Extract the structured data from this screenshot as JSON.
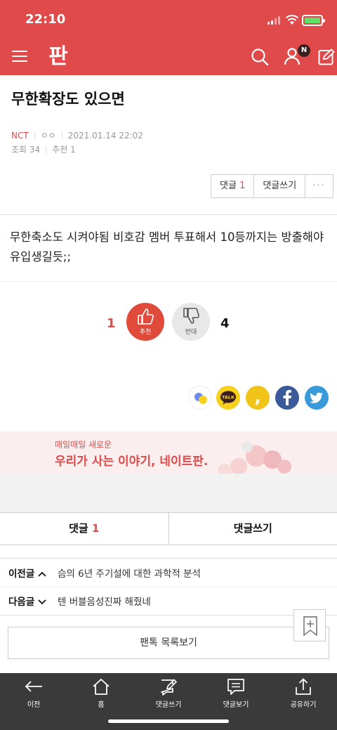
{
  "status": {
    "time": "22:10"
  },
  "header": {
    "logo_text": "판",
    "notification_badge": "N"
  },
  "article": {
    "title": "무한확장도 있으면",
    "author": "NCT",
    "author_id": "ㅇㅇ",
    "date": "2021.01.14 22:02",
    "views": "조회 34",
    "recommends": "추천 1",
    "body": "무한축소도 시켜야됨 비호감 멤버 투표해서 10등까지는 방출해야 유입생길듯;;"
  },
  "actions": {
    "comment_label": "댓글",
    "comment_count": "1",
    "write_comment": "댓글쓰기",
    "more": "···"
  },
  "vote": {
    "up_count": "1",
    "up_label": "추천",
    "down_label": "반대",
    "down_count": "4"
  },
  "share": {
    "talk_label": "TALK",
    "kakaostory_label": ","
  },
  "banner": {
    "sub": "매일매일 새로운",
    "main": "우리가 사는 이야기, 네이트판."
  },
  "tabs": {
    "comments_label": "댓글",
    "comments_count": "1",
    "write_label": "댓글쓰기"
  },
  "nav": {
    "prev_label": "이전글",
    "prev_title": "슴의 6년 주기설에 대한 과학적 분석",
    "next_label": "다음글",
    "next_title": "텐 버블음성진짜 해줬네"
  },
  "list_button": "팬톡 목록보기",
  "bottombar": {
    "back": "이전",
    "home": "홈",
    "write_comment": "댓글쓰기",
    "view_comments": "댓글보기",
    "share": "공유하기"
  },
  "colors": {
    "brand": "#e04a4a",
    "bottombar": "#3a3a3a"
  }
}
